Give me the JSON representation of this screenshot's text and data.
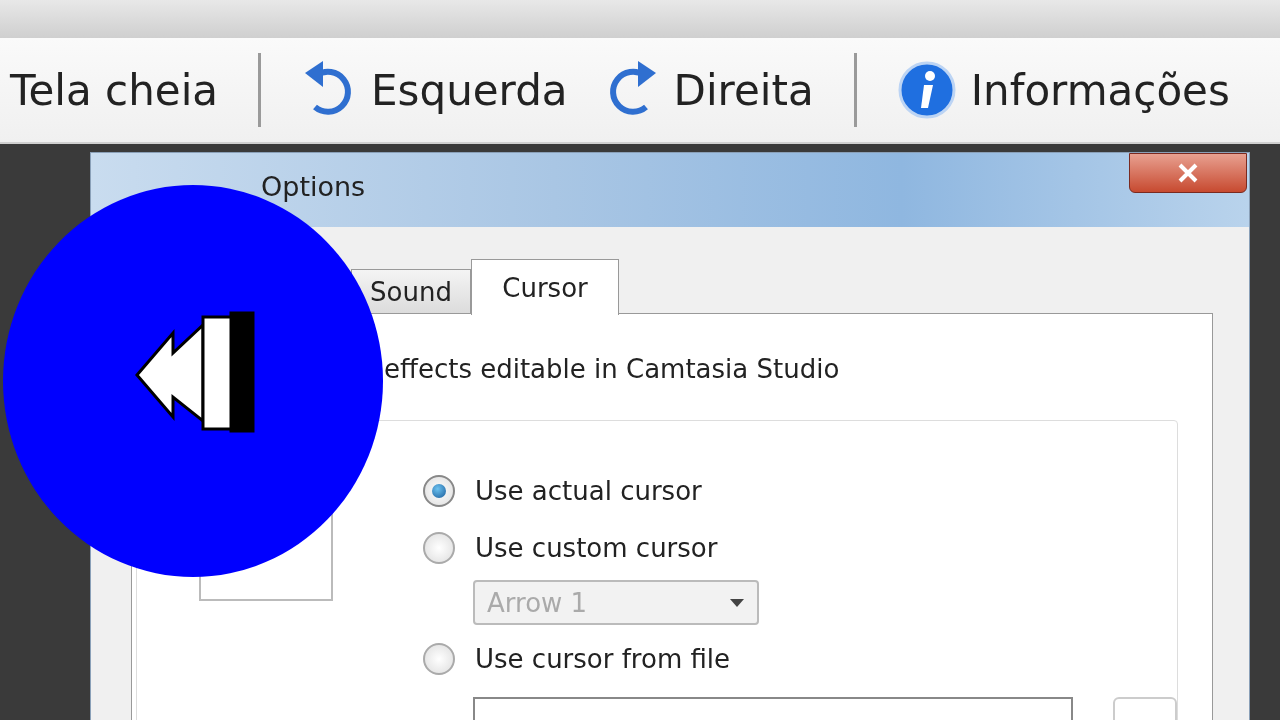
{
  "toolbar": {
    "items": [
      {
        "kind": "plain",
        "label": "Tela cheia"
      },
      {
        "kind": "separator"
      },
      {
        "kind": "left",
        "label": "Esquerda"
      },
      {
        "kind": "right",
        "label": "Direita"
      },
      {
        "kind": "separator"
      },
      {
        "kind": "info",
        "label": "Informações"
      }
    ]
  },
  "dialog": {
    "title": "Options",
    "tabs": [
      {
        "label": "Sound",
        "selected": false
      },
      {
        "label": "Cursor",
        "selected": true
      }
    ],
    "note": "effects editable in Camtasia Studio",
    "cursor_options": [
      {
        "label": "Use actual cursor",
        "selected": true
      },
      {
        "label": "Use custom cursor",
        "selected": false,
        "dropdown": {
          "value": "Arrow 1",
          "disabled": true
        }
      },
      {
        "label": "Use cursor from file",
        "selected": false
      }
    ]
  }
}
